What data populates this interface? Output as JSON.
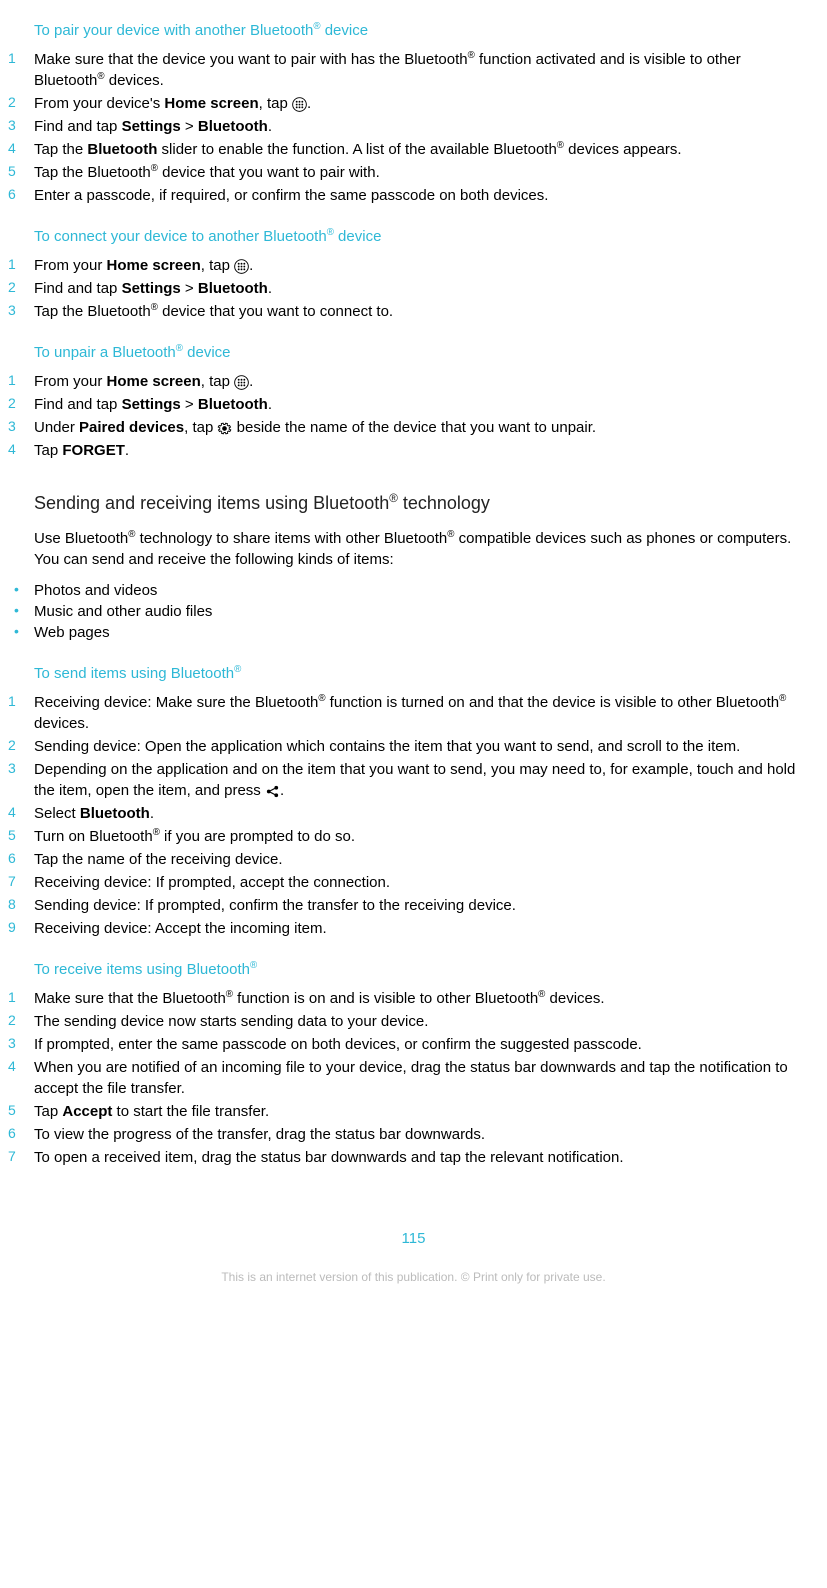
{
  "sections": [
    {
      "title_parts": [
        "To pair your device with another Bluetooth",
        "®",
        " device"
      ],
      "steps": [
        {
          "runs": [
            {
              "t": "Make sure that the device you want to pair with has the Bluetooth"
            },
            {
              "t": "®",
              "sup": true
            },
            {
              "t": " function activated and is visible to other Bluetooth"
            },
            {
              "t": "®",
              "sup": true
            },
            {
              "t": " devices."
            }
          ]
        },
        {
          "runs": [
            {
              "t": "From your device's "
            },
            {
              "t": "Home screen",
              "b": true
            },
            {
              "t": ", tap "
            },
            {
              "icon": "apps"
            },
            {
              "t": "."
            }
          ]
        },
        {
          "runs": [
            {
              "t": "Find and tap "
            },
            {
              "t": "Settings",
              "b": true
            },
            {
              "t": " > "
            },
            {
              "t": "Bluetooth",
              "b": true
            },
            {
              "t": "."
            }
          ]
        },
        {
          "runs": [
            {
              "t": "Tap the "
            },
            {
              "t": "Bluetooth",
              "b": true
            },
            {
              "t": " slider to enable the function. A list of the available Bluetooth"
            },
            {
              "t": "®",
              "sup": true
            },
            {
              "t": " devices appears."
            }
          ]
        },
        {
          "runs": [
            {
              "t": "Tap the Bluetooth"
            },
            {
              "t": "®",
              "sup": true
            },
            {
              "t": " device that you want to pair with."
            }
          ]
        },
        {
          "runs": [
            {
              "t": "Enter a passcode, if required, or confirm the same passcode on both devices."
            }
          ]
        }
      ]
    },
    {
      "title_parts": [
        "To connect your device to another Bluetooth",
        "®",
        " device"
      ],
      "steps": [
        {
          "runs": [
            {
              "t": "From your "
            },
            {
              "t": "Home screen",
              "b": true
            },
            {
              "t": ", tap "
            },
            {
              "icon": "apps"
            },
            {
              "t": "."
            }
          ]
        },
        {
          "runs": [
            {
              "t": "Find and tap "
            },
            {
              "t": "Settings",
              "b": true
            },
            {
              "t": " > "
            },
            {
              "t": "Bluetooth",
              "b": true
            },
            {
              "t": "."
            }
          ]
        },
        {
          "runs": [
            {
              "t": "Tap the Bluetooth"
            },
            {
              "t": "®",
              "sup": true
            },
            {
              "t": " device that you want to connect to."
            }
          ]
        }
      ]
    },
    {
      "title_parts": [
        "To unpair a Bluetooth",
        "®",
        " device"
      ],
      "steps": [
        {
          "runs": [
            {
              "t": "From your "
            },
            {
              "t": "Home screen",
              "b": true
            },
            {
              "t": ", tap "
            },
            {
              "icon": "apps"
            },
            {
              "t": "."
            }
          ]
        },
        {
          "runs": [
            {
              "t": "Find and tap "
            },
            {
              "t": "Settings",
              "b": true
            },
            {
              "t": " > "
            },
            {
              "t": "Bluetooth",
              "b": true
            },
            {
              "t": "."
            }
          ]
        },
        {
          "runs": [
            {
              "t": "Under "
            },
            {
              "t": "Paired devices",
              "b": true
            },
            {
              "t": ", tap "
            },
            {
              "icon": "gear"
            },
            {
              "t": " beside the name of the device that you want to unpair."
            }
          ]
        },
        {
          "runs": [
            {
              "t": "Tap "
            },
            {
              "t": "FORGET",
              "b": true
            },
            {
              "t": "."
            }
          ]
        }
      ]
    }
  ],
  "subheading_parts": [
    "Sending and receiving items using Bluetooth",
    "®",
    " technology"
  ],
  "intro_para_runs": [
    {
      "t": "Use Bluetooth"
    },
    {
      "t": "®",
      "sup": true
    },
    {
      "t": " technology to share items with other Bluetooth"
    },
    {
      "t": "®",
      "sup": true
    },
    {
      "t": " compatible devices such as phones or computers. You can send and receive the following kinds of items:"
    }
  ],
  "bullets": [
    "Photos and videos",
    "Music and other audio files",
    "Web pages"
  ],
  "sections2": [
    {
      "title_parts": [
        "To send items using Bluetooth",
        "®",
        ""
      ],
      "steps": [
        {
          "runs": [
            {
              "t": "Receiving device: Make sure the Bluetooth"
            },
            {
              "t": "®",
              "sup": true
            },
            {
              "t": " function is turned on and that the device is visible to other Bluetooth"
            },
            {
              "t": "®",
              "sup": true
            },
            {
              "t": " devices."
            }
          ]
        },
        {
          "runs": [
            {
              "t": "Sending device: Open the application which contains the item that you want to send, and scroll to the item."
            }
          ]
        },
        {
          "runs": [
            {
              "t": "Depending on the application and on the item that you want to send, you may need to, for example, touch and hold the item, open the item, and press "
            },
            {
              "icon": "share"
            },
            {
              "t": "."
            }
          ]
        },
        {
          "runs": [
            {
              "t": "Select "
            },
            {
              "t": "Bluetooth",
              "b": true
            },
            {
              "t": "."
            }
          ]
        },
        {
          "runs": [
            {
              "t": "Turn on Bluetooth"
            },
            {
              "t": "®",
              "sup": true
            },
            {
              "t": " if you are prompted to do so."
            }
          ]
        },
        {
          "runs": [
            {
              "t": "Tap the name of the receiving device."
            }
          ]
        },
        {
          "runs": [
            {
              "t": "Receiving device: If prompted, accept the connection."
            }
          ]
        },
        {
          "runs": [
            {
              "t": "Sending device: If prompted, confirm the transfer to the receiving device."
            }
          ]
        },
        {
          "runs": [
            {
              "t": "Receiving device: Accept the incoming item."
            }
          ]
        }
      ]
    },
    {
      "title_parts": [
        "To receive items using Bluetooth",
        "®",
        ""
      ],
      "steps": [
        {
          "runs": [
            {
              "t": "Make sure that the Bluetooth"
            },
            {
              "t": "®",
              "sup": true
            },
            {
              "t": " function is on and is visible to other Bluetooth"
            },
            {
              "t": "®",
              "sup": true
            },
            {
              "t": " devices."
            }
          ]
        },
        {
          "runs": [
            {
              "t": "The sending device now starts sending data to your device."
            }
          ]
        },
        {
          "runs": [
            {
              "t": "If prompted, enter the same passcode on both devices, or confirm the suggested passcode."
            }
          ]
        },
        {
          "runs": [
            {
              "t": "When you are notified of an incoming file to your device, drag the status bar downwards and tap the notification to accept the file transfer."
            }
          ]
        },
        {
          "runs": [
            {
              "t": "Tap "
            },
            {
              "t": "Accept",
              "b": true
            },
            {
              "t": " to start the file transfer."
            }
          ]
        },
        {
          "runs": [
            {
              "t": "To view the progress of the transfer, drag the status bar downwards."
            }
          ]
        },
        {
          "runs": [
            {
              "t": "To open a received item, drag the status bar downwards and tap the relevant notification."
            }
          ]
        }
      ]
    }
  ],
  "page_number": "115",
  "footer_note": "This is an internet version of this publication. © Print only for private use."
}
